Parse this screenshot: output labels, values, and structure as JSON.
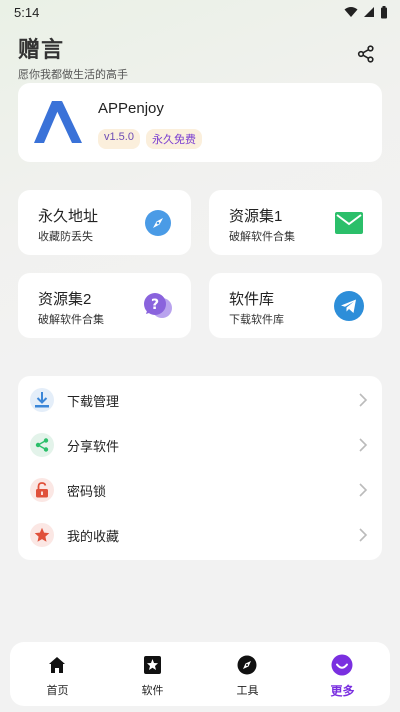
{
  "status": {
    "time": "5:14"
  },
  "header": {
    "title": "赠言",
    "subtitle": "愿你我都做生活的高手"
  },
  "app": {
    "name": "APPenjoy",
    "version": "v1.5.0",
    "price_badge": "永久免费"
  },
  "tiles": [
    {
      "title": "永久地址",
      "subtitle": "收藏防丢失",
      "icon": "compass-icon"
    },
    {
      "title": "资源集1",
      "subtitle": "破解软件合集",
      "icon": "mail-icon"
    },
    {
      "title": "资源集2",
      "subtitle": "破解软件合集",
      "icon": "question-chat-icon"
    },
    {
      "title": "软件库",
      "subtitle": "下载软件库",
      "icon": "telegram-icon"
    }
  ],
  "menu": [
    {
      "label": "下载管理",
      "icon": "download-icon"
    },
    {
      "label": "分享软件",
      "icon": "share-icon"
    },
    {
      "label": "密码锁",
      "icon": "lock-icon"
    },
    {
      "label": "我的收藏",
      "icon": "star-icon"
    }
  ],
  "tabbar": [
    {
      "label": "首页",
      "icon": "home-icon"
    },
    {
      "label": "软件",
      "icon": "star-box-icon"
    },
    {
      "label": "工具",
      "icon": "compass-icon"
    },
    {
      "label": "更多",
      "icon": "smile-icon",
      "active": true
    }
  ],
  "colors": {
    "accent": "#7a2fe0",
    "blue": "#3a86d8",
    "green": "#2bbf6a",
    "red": "#e0503a"
  }
}
